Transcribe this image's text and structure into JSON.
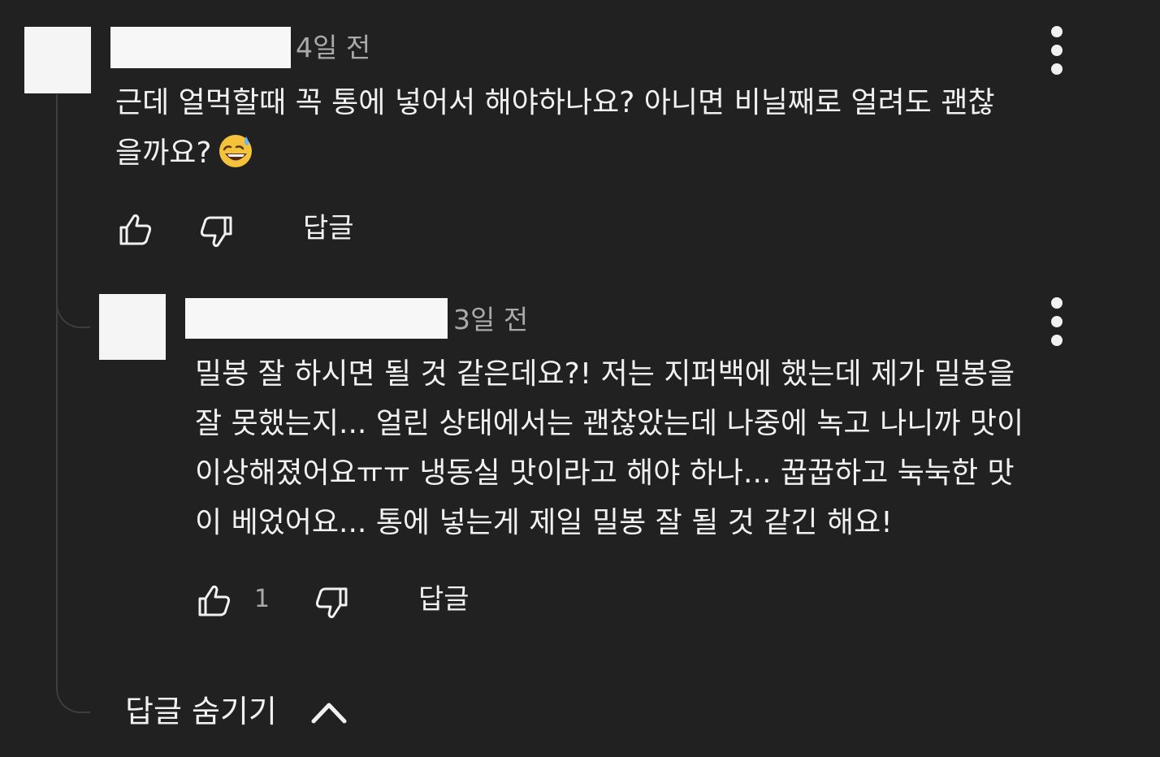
{
  "comment": {
    "timestamp": "4일 전",
    "text_line1": "근데 얼먹할때 꼭 통에 넣어서 해야하나요? 아니면 비닐째로 얼려도 괜찮",
    "text_line2": "을까요?",
    "emoji": "sweat-smile-emoji",
    "reply_label": "답글"
  },
  "reply": {
    "timestamp": "3일 전",
    "text_lines": [
      "밀봉 잘 하시면 될 것 같은데요?! 저는 지퍼백에 했는데 제가 밀봉을",
      "잘 못했는지... 얼린 상태에서는 괜찮았는데 나중에 녹고 나니까 맛이",
      "이상해졌어요ㅠㅠ 냉동실 맛이라고 해야 하나... 꿉꿉하고 눅눅한 맛",
      "이 베었어요... 통에 넣는게 제일 밀봉 잘 될 것 같긴 해요!"
    ],
    "like_count": "1",
    "reply_label": "답글"
  },
  "hide_replies_label": "답글 숨기기",
  "colors": {
    "background": "#212121",
    "text": "#f1f1f1",
    "muted": "#aaaaaa"
  }
}
